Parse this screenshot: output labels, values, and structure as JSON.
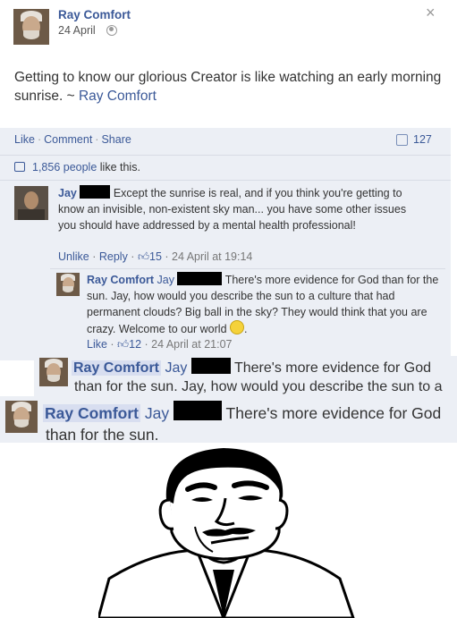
{
  "post": {
    "author": "Ray Comfort",
    "date": "24 April",
    "close": "×",
    "text_main": "Getting to know our glorious Creator is like watching an early morning sunrise. ~ ",
    "text_link": "Ray Comfort",
    "actions": {
      "like": "Like",
      "comment": "Comment",
      "share": "Share"
    },
    "share_count": "127",
    "likes_count": "1,856 people",
    "likes_suffix": " like this."
  },
  "comments": [
    {
      "name": "Jay",
      "text": "Except the sunrise is real, and if you think you're getting to know an invisible, non-existent sky man... you have some other issues you should have addressed by a mental health professional!",
      "unlike": "Unlike",
      "reply": "Reply",
      "likes": "15",
      "time": "24 April at 19:14"
    }
  ],
  "reply": {
    "name": "Ray Comfort",
    "mention": "Jay",
    "text": "There's more evidence for God than for the sun. Jay, how would you describe the sun to a culture that had permanent clouds? Big ball in the sky? They would think that you are crazy. Welcome to our world",
    "like": "Like",
    "likes": "12",
    "time": "24 April at 21:07"
  },
  "zoom1": {
    "name": "Ray Comfort",
    "mention": "Jay",
    "line1": "There's more evidence for God",
    "line2": "than for the sun. Jay, how would you describe the sun to a"
  },
  "zoom2": {
    "name": "Ray Comfort",
    "mention": "Jay",
    "line1": "There's more evidence for God",
    "line2": "than for the sun."
  },
  "icons": [
    "globe-icon",
    "close-icon",
    "share-icon",
    "thumb-icon",
    "smiley-icon"
  ],
  "colors": {
    "link": "#3b5998",
    "panel": "#eceff5",
    "text": "#333333"
  }
}
